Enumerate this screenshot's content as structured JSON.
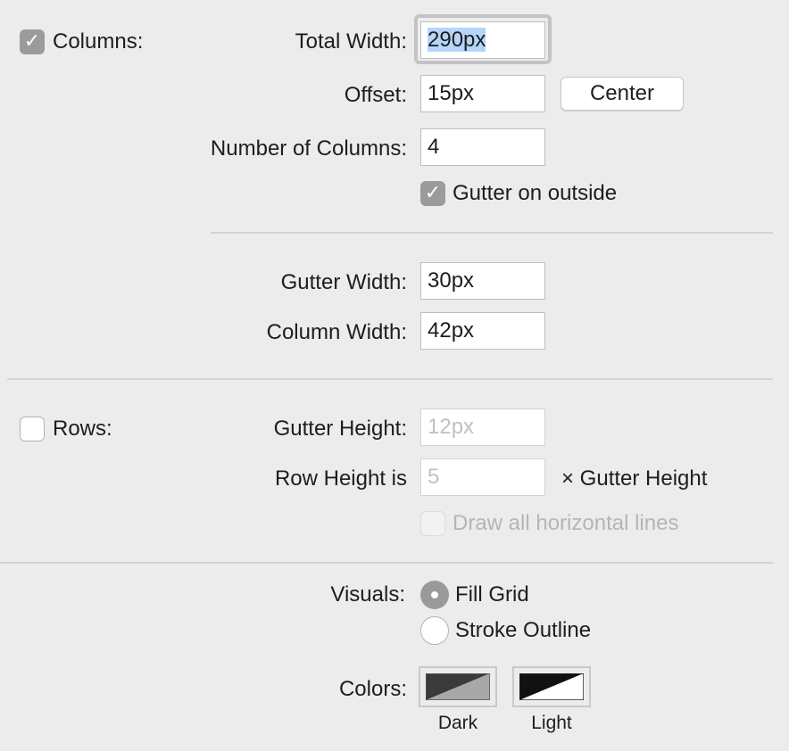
{
  "columns": {
    "enabled_label": "Columns:",
    "total_width_label": "Total Width:",
    "total_width_value": "290px",
    "offset_label": "Offset:",
    "offset_value": "15px",
    "center_button": "Center",
    "number_label": "Number of Columns:",
    "number_value": "4",
    "gutter_outside_label": "Gutter on outside",
    "gutter_width_label": "Gutter Width:",
    "gutter_width_value": "30px",
    "column_width_label": "Column Width:",
    "column_width_value": "42px"
  },
  "rows": {
    "enabled_label": "Rows:",
    "gutter_height_label": "Gutter Height:",
    "gutter_height_value": "12px",
    "row_height_label": "Row Height is",
    "row_height_value": "5",
    "row_height_suffix": "× Gutter Height",
    "draw_lines_label": "Draw all horizontal lines"
  },
  "visuals": {
    "label": "Visuals:",
    "fill_grid": "Fill Grid",
    "stroke_outline": "Stroke Outline"
  },
  "colors": {
    "label": "Colors:",
    "dark": "Dark",
    "light": "Light",
    "dark_swatch": [
      "#3a3a3a",
      "#a8a8a8"
    ],
    "light_swatch": [
      "#111111",
      "#ffffff"
    ]
  },
  "checkmark_glyph": "✓"
}
